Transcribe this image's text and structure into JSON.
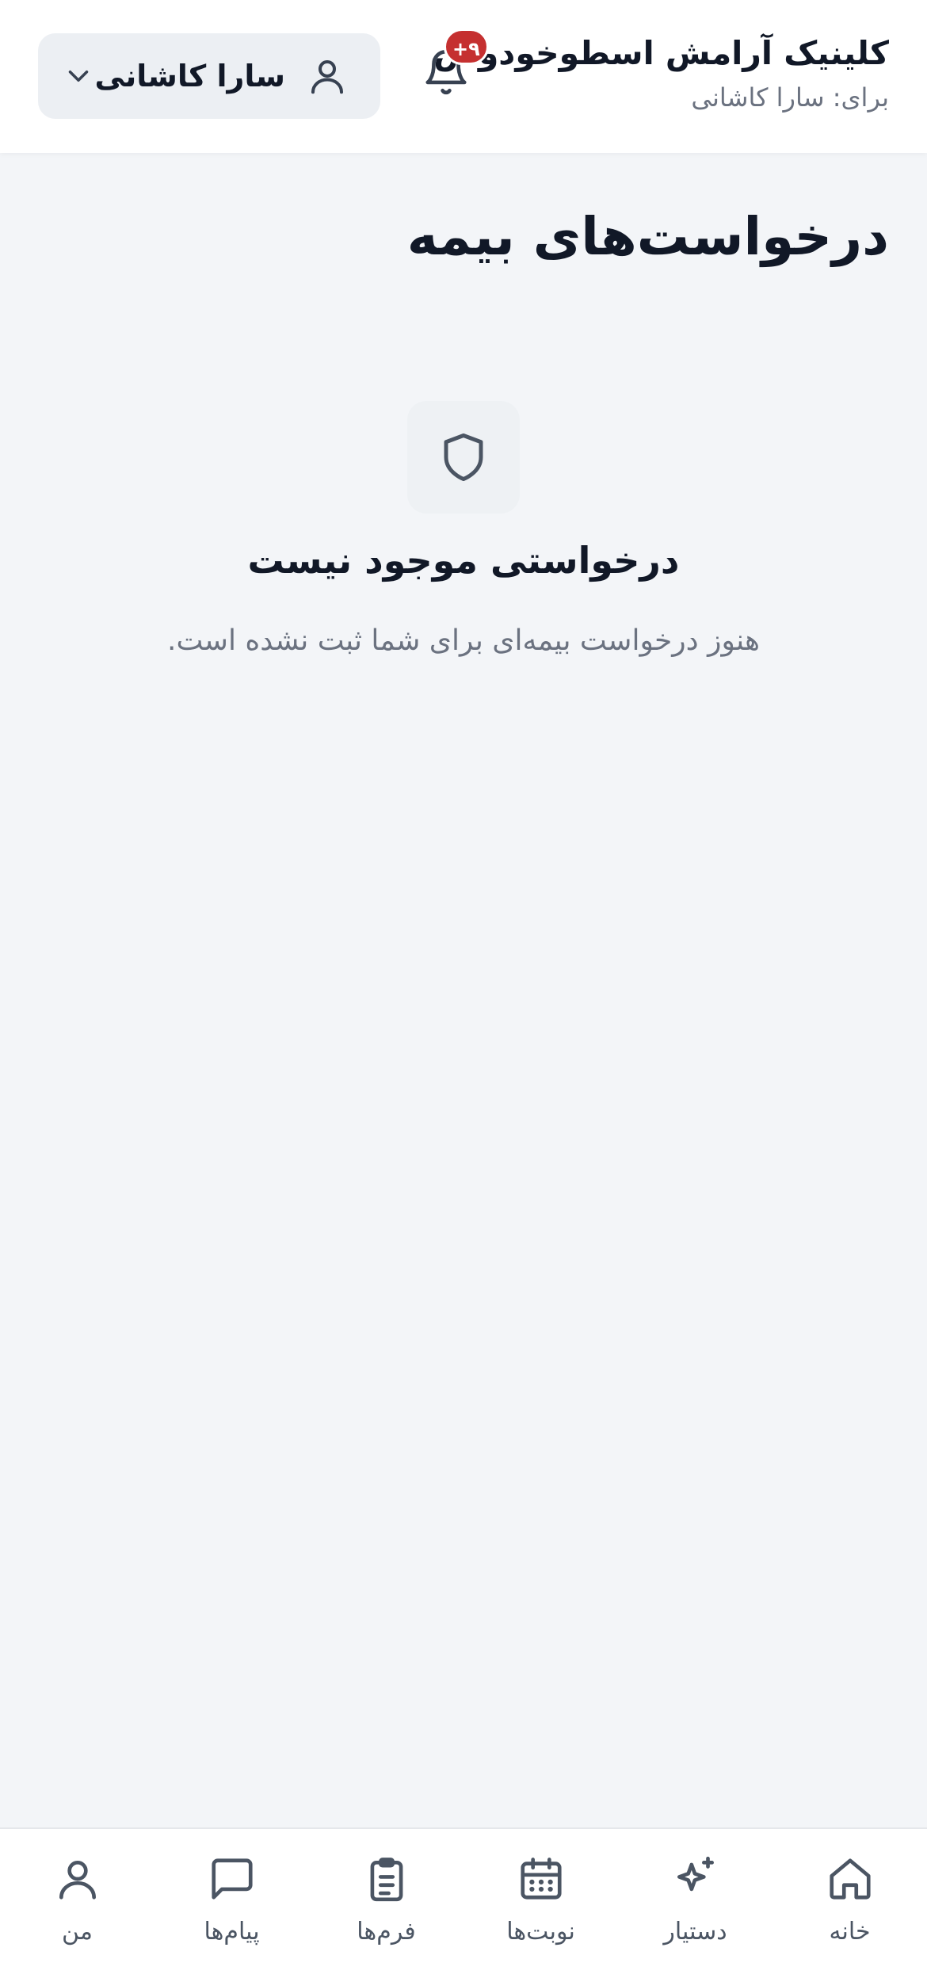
{
  "header": {
    "clinic_name": "کلینیک آرامش اسطوخودوس",
    "for_label": "برای: سارا کاشانی",
    "notifications_badge": "۹+",
    "user_switcher": {
      "name": "سارا کاشانی"
    }
  },
  "page": {
    "title": "درخواست‌های بیمه"
  },
  "empty_state": {
    "icon": "shield-icon",
    "title": "درخواستی موجود نیست",
    "subtitle": "هنوز درخواست بیمه‌ای برای شما ثبت نشده است."
  },
  "bottom_nav": {
    "items": [
      {
        "label": "خانه",
        "icon": "home-icon"
      },
      {
        "label": "دستیار",
        "icon": "sparkles-icon"
      },
      {
        "label": "نوبت‌ها",
        "icon": "calendar-icon"
      },
      {
        "label": "فرم‌ها",
        "icon": "clipboard-icon"
      },
      {
        "label": "پیام‌ها",
        "icon": "message-icon"
      },
      {
        "label": "من",
        "icon": "user-icon"
      }
    ]
  },
  "colors": {
    "background": "#f3f5f8",
    "header_bg": "#ffffff",
    "badge": "#c53030",
    "text_primary": "#111827",
    "text_secondary": "#6b7280",
    "icon": "#4b5563"
  }
}
